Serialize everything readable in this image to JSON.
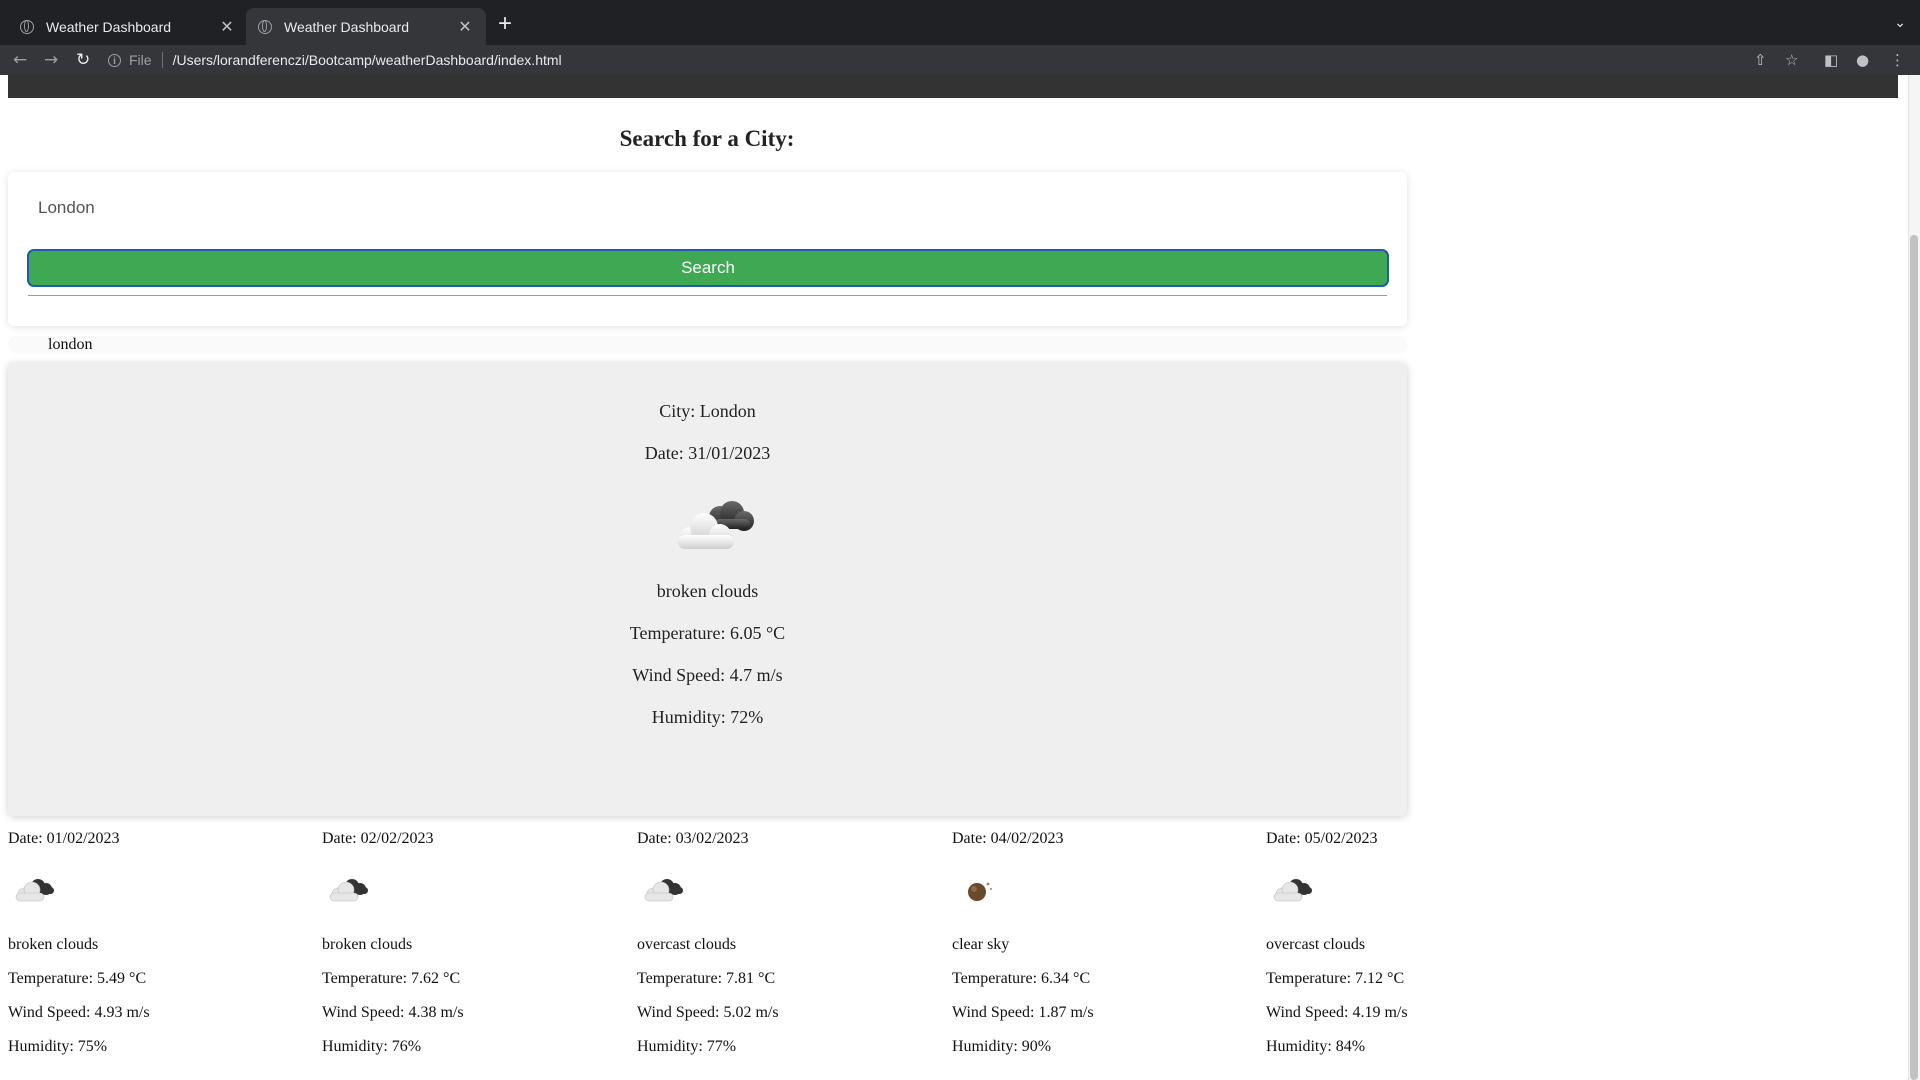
{
  "browser": {
    "tabs": [
      {
        "title": "Weather Dashboard",
        "active": false
      },
      {
        "title": "Weather Dashboard",
        "active": true
      }
    ],
    "new_tab": "+",
    "address": {
      "scheme_label": "File",
      "url": "/Users/lorandferenczi/Bootcamp/weatherDashboard/index.html"
    }
  },
  "search": {
    "heading": "Search for a City:",
    "input_value": "London",
    "button_label": "Search"
  },
  "history": [
    "london"
  ],
  "current": {
    "city": "City: London",
    "date": "Date: 31/01/2023",
    "icon": "broken-clouds-icon",
    "description": "broken clouds",
    "temperature": "Temperature: 6.05 °C",
    "wind": "Wind Speed: 4.7 m/s",
    "humidity": "Humidity: 72%"
  },
  "forecast": [
    {
      "date": "Date: 01/02/2023",
      "icon": "broken-clouds-icon",
      "description": "broken clouds",
      "temperature": "Temperature: 5.49 °C",
      "wind": "Wind Speed: 4.93 m/s",
      "humidity": "Humidity: 75%"
    },
    {
      "date": "Date: 02/02/2023",
      "icon": "broken-clouds-icon",
      "description": "broken clouds",
      "temperature": "Temperature: 7.62 °C",
      "wind": "Wind Speed: 4.38 m/s",
      "humidity": "Humidity: 76%"
    },
    {
      "date": "Date: 03/02/2023",
      "icon": "overcast-clouds-icon",
      "description": "overcast clouds",
      "temperature": "Temperature: 7.81 °C",
      "wind": "Wind Speed: 5.02 m/s",
      "humidity": "Humidity: 77%"
    },
    {
      "date": "Date: 04/02/2023",
      "icon": "clear-sky-night-icon",
      "description": "clear sky",
      "temperature": "Temperature: 6.34 °C",
      "wind": "Wind Speed: 1.87 m/s",
      "humidity": "Humidity: 90%"
    },
    {
      "date": "Date: 05/02/2023",
      "icon": "overcast-clouds-icon",
      "description": "overcast clouds",
      "temperature": "Temperature: 7.12 °C",
      "wind": "Wind Speed: 4.19 m/s",
      "humidity": "Humidity: 84%"
    }
  ],
  "colors": {
    "search_button": "#3ea952",
    "search_button_border": "#1e5bb0",
    "current_card_bg": "#efefef",
    "header_strip": "#333333"
  }
}
